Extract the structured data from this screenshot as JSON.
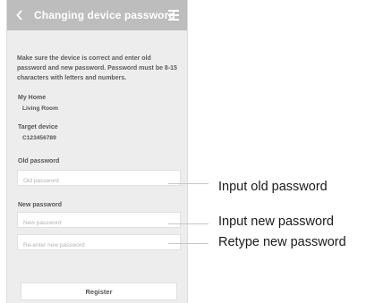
{
  "header": {
    "title": "Changing device password"
  },
  "instructions": "Make sure the device is correct and enter old password and new password. Password must be 8-15 characters with letters and numbers.",
  "home": {
    "label": "My Home",
    "value": "Living Room"
  },
  "target_device": {
    "label": "Target device",
    "value": "C123456789"
  },
  "old_password": {
    "label": "Old password",
    "placeholder": "Old password"
  },
  "new_password": {
    "label": "New password",
    "placeholder": "New password",
    "reenter_placeholder": "Re-enter new password"
  },
  "register_label": "Register",
  "callouts": {
    "old": "Input old password",
    "new": "Input new password",
    "retype": "Retype new password"
  }
}
